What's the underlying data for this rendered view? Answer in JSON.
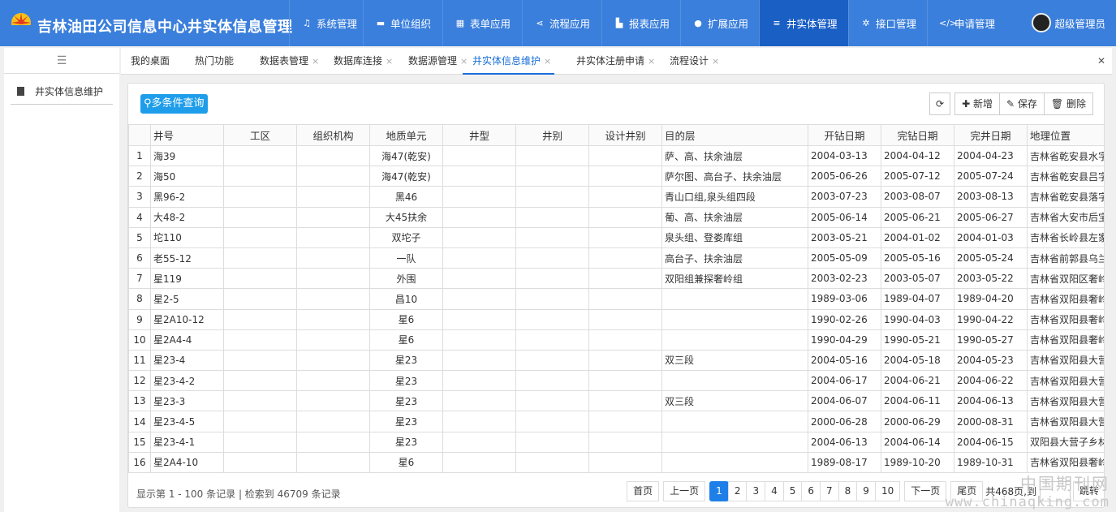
{
  "app": {
    "title": "吉林油田公司信息中心井实体信息管理"
  },
  "nav": [
    {
      "label": "系统管理",
      "icon": "wrench-icon",
      "glyph": "♫"
    },
    {
      "label": "单位组织",
      "icon": "vehicle-icon",
      "glyph": "▬"
    },
    {
      "label": "表单应用",
      "icon": "table-icon",
      "glyph": "▦"
    },
    {
      "label": "流程应用",
      "icon": "share-icon",
      "glyph": "⋖"
    },
    {
      "label": "报表应用",
      "icon": "chart-icon",
      "glyph": "▙"
    },
    {
      "label": "扩展应用",
      "icon": "compass-icon",
      "glyph": "●"
    },
    {
      "label": "井实体管理",
      "icon": "database-icon",
      "glyph": "≡"
    },
    {
      "label": "接口管理",
      "icon": "gears-icon",
      "glyph": "✲"
    },
    {
      "label": "申请管理",
      "icon": "code-icon",
      "glyph": "</>"
    }
  ],
  "nav_active": "井实体管理",
  "user": {
    "name": "超级管理员"
  },
  "sidebar": {
    "items": [
      {
        "label": "井实体信息维护"
      }
    ]
  },
  "tabs": [
    {
      "label": "我的桌面",
      "closable": false
    },
    {
      "label": "热门功能",
      "closable": false
    },
    {
      "label": "数据表管理",
      "closable": true
    },
    {
      "label": "数据库连接",
      "closable": true
    },
    {
      "label": "数据源管理",
      "closable": true
    },
    {
      "label": "井实体信息维护",
      "closable": true
    },
    {
      "label": "井实体注册申请",
      "closable": true
    },
    {
      "label": "流程设计",
      "closable": true
    }
  ],
  "active_tab": "井实体信息维护",
  "toolbar": {
    "query_label": "多条件查询",
    "add_label": "新增",
    "save_label": "保存",
    "delete_label": "删除"
  },
  "table": {
    "columns": [
      "井号",
      "工区",
      "组织机构",
      "地质单元",
      "井型",
      "井别",
      "设计井别",
      "目的层",
      "开钻日期",
      "完钻日期",
      "完井日期",
      "地理位置"
    ],
    "rows": [
      [
        "1",
        "海39",
        "",
        "",
        "海47(乾安)",
        "",
        "",
        "",
        "萨、高、扶余油层",
        "2004-03-13",
        "2004-04-12",
        "2004-04-23",
        "吉林省乾安县水字"
      ],
      [
        "2",
        "海50",
        "",
        "",
        "海47(乾安)",
        "",
        "",
        "",
        "萨尔图、高台子、扶余油层",
        "2005-06-26",
        "2005-07-12",
        "2005-07-24",
        "吉林省乾安县吕字"
      ],
      [
        "3",
        "黑96-2",
        "",
        "",
        "黑46",
        "",
        "",
        "",
        "青山口组,泉头组四段",
        "2003-07-23",
        "2003-08-07",
        "2003-08-13",
        "吉林省乾安县落字"
      ],
      [
        "4",
        "大48-2",
        "",
        "",
        "大45扶余",
        "",
        "",
        "",
        "葡、高、扶余油层",
        "2005-06-14",
        "2005-06-21",
        "2005-06-27",
        "吉林省大安市后宝"
      ],
      [
        "5",
        "坨110",
        "",
        "",
        "双坨子",
        "",
        "",
        "",
        "泉头组、登娄库组",
        "2003-05-21",
        "2004-01-02",
        "2004-01-03",
        "吉林省长岭县左家"
      ],
      [
        "6",
        "老55-12",
        "",
        "",
        "一队",
        "",
        "",
        "",
        "高台子、扶余油层",
        "2005-05-09",
        "2005-05-16",
        "2005-05-24",
        "吉林省前郭县乌兰"
      ],
      [
        "7",
        "星119",
        "",
        "",
        "外围",
        "",
        "",
        "",
        "双阳组兼探奢岭组",
        "2003-02-23",
        "2003-05-07",
        "2003-05-22",
        "吉林省双阳区奢岭"
      ],
      [
        "8",
        "星2-5",
        "",
        "",
        "昌10",
        "",
        "",
        "",
        "",
        "1989-03-06",
        "1989-04-07",
        "1989-04-20",
        "吉林省双阳县奢岭"
      ],
      [
        "9",
        "星2A10-12",
        "",
        "",
        "星6",
        "",
        "",
        "",
        "",
        "1990-02-26",
        "1990-04-03",
        "1990-04-22",
        "吉林省双阳县奢岭"
      ],
      [
        "10",
        "星2A4-4",
        "",
        "",
        "星6",
        "",
        "",
        "",
        "",
        "1990-04-29",
        "1990-05-21",
        "1990-05-27",
        "吉林省双阳县奢岭"
      ],
      [
        "11",
        "星23-4",
        "",
        "",
        "星23",
        "",
        "",
        "",
        "双三段",
        "2004-05-16",
        "2004-05-18",
        "2004-05-23",
        "吉林省双阳县大营"
      ],
      [
        "12",
        "星23-4-2",
        "",
        "",
        "星23",
        "",
        "",
        "",
        "",
        "2004-06-17",
        "2004-06-21",
        "2004-06-22",
        "吉林省双阳县大营"
      ],
      [
        "13",
        "星23-3",
        "",
        "",
        "星23",
        "",
        "",
        "",
        "双三段",
        "2004-06-07",
        "2004-06-11",
        "2004-06-13",
        "吉林省双阳县大营"
      ],
      [
        "14",
        "星23-4-5",
        "",
        "",
        "星23",
        "",
        "",
        "",
        "",
        "2000-06-28",
        "2000-06-29",
        "2000-08-31",
        "吉林省双阳县大营"
      ],
      [
        "15",
        "星23-4-1",
        "",
        "",
        "星23",
        "",
        "",
        "",
        "",
        "2004-06-13",
        "2004-06-14",
        "2004-06-15",
        "双阳县大营子乡林"
      ],
      [
        "16",
        "星2A4-10",
        "",
        "",
        "星6",
        "",
        "",
        "",
        "",
        "1989-08-17",
        "1989-10-20",
        "1989-10-31",
        "吉林省双阳县奢岭"
      ]
    ]
  },
  "footer": {
    "summary": "显示第 1 - 100 条记录 | 检索到 46709 条记录",
    "first": "首页",
    "prev": "上一页",
    "pages": [
      "1",
      "2",
      "3",
      "4",
      "5",
      "6",
      "7",
      "8",
      "9",
      "10"
    ],
    "current_page": "1",
    "next": "下一页",
    "last": "尾页",
    "total_pages": "共468页,到",
    "jump_value": "",
    "jump": "跳转"
  },
  "watermark": {
    "line1": "中国期刊网",
    "line2": "www.chinaqking.com"
  },
  "colors": {
    "header_blue": "#3a7fdc",
    "nav_active": "#1a5fc4",
    "accent": "#1e7fe8",
    "query_button": "#1e9dea"
  }
}
